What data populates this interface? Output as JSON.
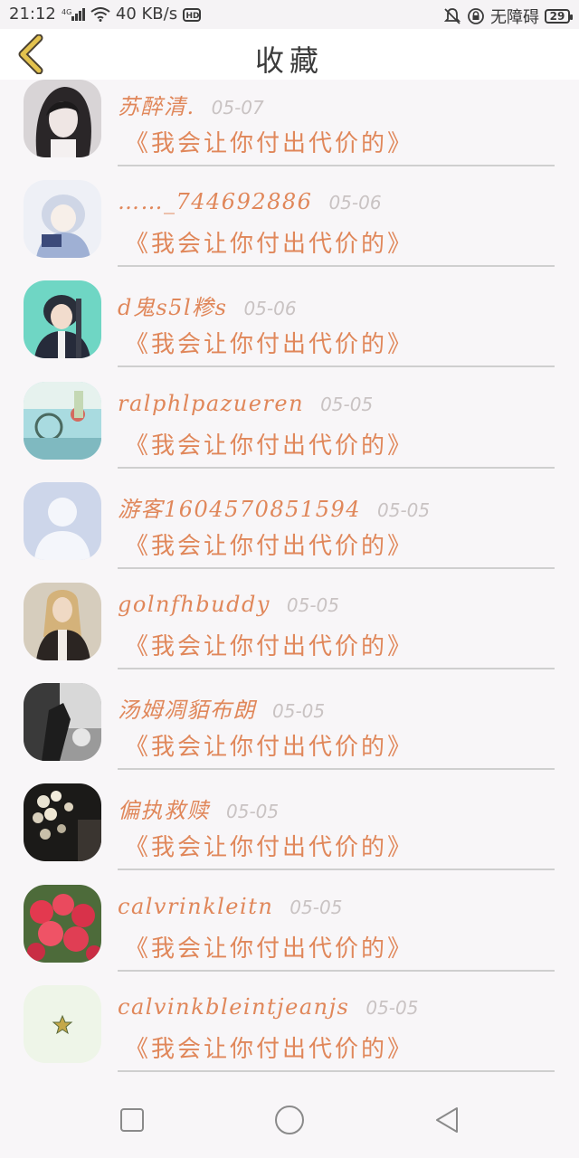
{
  "status_bar": {
    "time": "21:12",
    "network": "4G",
    "speed": "40 KB/s",
    "hd": "HD",
    "accessibility": "无障碍",
    "battery": "29"
  },
  "header": {
    "title": "收藏"
  },
  "items": [
    {
      "username": "苏醉清.",
      "date": "05-07",
      "message": "《我会让你付出代价的》"
    },
    {
      "username": "……_744692886",
      "date": "05-06",
      "message": "《我会让你付出代价的》"
    },
    {
      "username": "d鬼s5l糁s",
      "date": "05-06",
      "message": "《我会让你付出代价的》"
    },
    {
      "username": "ralphlpazueren",
      "date": "05-05",
      "message": "《我会让你付出代价的》"
    },
    {
      "username": "游客1604570851594",
      "date": "05-05",
      "message": "《我会让你付出代价的》"
    },
    {
      "username": "golnfhbuddy",
      "date": "05-05",
      "message": "《我会让你付出代价的》"
    },
    {
      "username": "汤姆凋貊布朗",
      "date": "05-05",
      "message": "《我会让你付出代价的》"
    },
    {
      "username": "偏执救赎",
      "date": "05-05",
      "message": "《我会让你付出代价的》"
    },
    {
      "username": "calvrinkleitn",
      "date": "05-05",
      "message": "《我会让你付出代价的》"
    },
    {
      "username": "calvinkbleintjeanjs",
      "date": "05-05",
      "message": "《我会让你付出代价的》"
    }
  ],
  "colors": {
    "accent": "#e0875a",
    "back_arrow": "#d9b23a"
  }
}
